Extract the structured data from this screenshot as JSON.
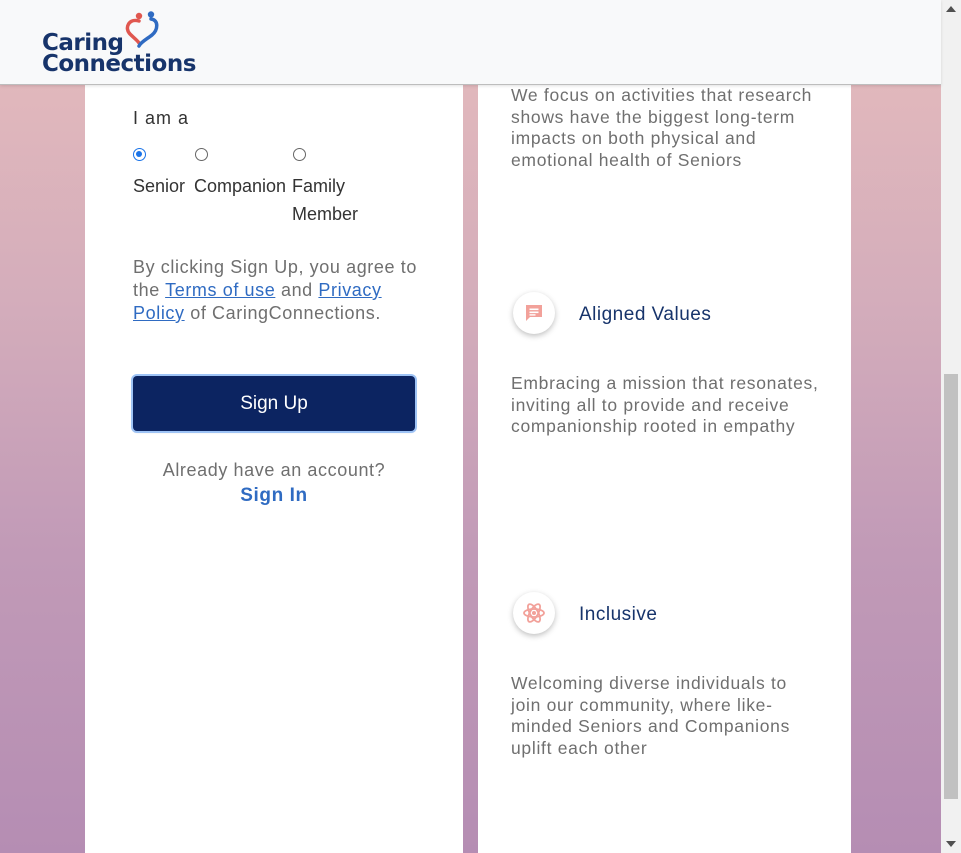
{
  "brand": {
    "line1": "Caring",
    "line2": "Connections",
    "colors": {
      "navy": "#17346b",
      "heart_red": "#e0574f",
      "heart_blue": "#2f6bc2"
    }
  },
  "signup_form": {
    "role_label": "I am a",
    "roles": [
      {
        "label": "Senior",
        "checked": true
      },
      {
        "label": "Companion",
        "checked": false
      },
      {
        "label_line1": "Family",
        "label_line2": "Member",
        "checked": false
      }
    ],
    "agree_prefix": "By clicking Sign Up, you agree to the",
    "terms_link": "Terms of use",
    "agree_and": "and",
    "privacy_link": "Privacy Policy",
    "agree_suffix": "of CaringConnections.",
    "signup_button": "Sign Up",
    "already_text": "Already have an account?",
    "signin_link": "Sign In"
  },
  "features": {
    "intro_text": "We focus on activities that research shows have the biggest long-term impacts on both physical and emotional health of Seniors",
    "items": [
      {
        "title": "Aligned Values",
        "icon": "message-icon",
        "description": "Embracing a mission that resonates, inviting all to provide and receive companionship rooted in empathy"
      },
      {
        "title": "Inclusive",
        "icon": "atom-icon",
        "description": "Welcoming diverse individuals to join our community, where like-minded Seniors and Companions uplift each other"
      }
    ]
  },
  "theme": {
    "accent": "#0c2461",
    "link": "#2f6bc2",
    "icon_color": "#f2a19a"
  }
}
